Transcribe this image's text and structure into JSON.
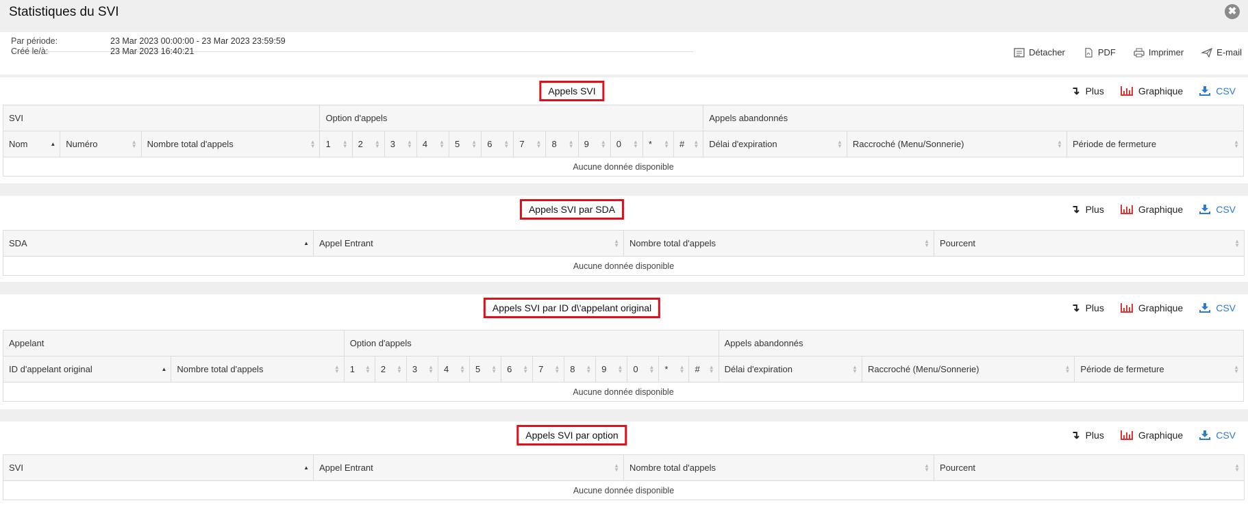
{
  "window": {
    "title": "Statistiques du SVI",
    "close_glyph": "✖"
  },
  "info": {
    "period_label": "Par période:",
    "period_value": "23 Mar 2023 00:00:00 - 23 Mar 2023 23:59:59",
    "created_label": "Créé le/à:",
    "created_value": "23 Mar 2023 16:40:21"
  },
  "actions": {
    "detach": "Détacher",
    "pdf": "PDF",
    "print": "Imprimer",
    "email": "E-mail"
  },
  "tools": {
    "plus": "Plus",
    "chart": "Graphique",
    "csv": "CSV"
  },
  "empty_text": "Aucune donnée disponible",
  "sections": [
    {
      "title": "Appels SVI",
      "groups": [
        "SVI",
        "Option d'appels",
        "Appels abandonnés"
      ],
      "columns": [
        "Nom",
        "Numéro",
        "Nombre total d'appels",
        "1",
        "2",
        "3",
        "4",
        "5",
        "6",
        "7",
        "8",
        "9",
        "0",
        "*",
        "#",
        "Délai d'expiration",
        "Raccroché (Menu/Sonnerie)",
        "Période de fermeture"
      ]
    },
    {
      "title": "Appels SVI par SDA",
      "columns": [
        "SDA",
        "Appel Entrant",
        "Nombre total d'appels",
        "Pourcent"
      ]
    },
    {
      "title": "Appels SVI par ID d\\'appelant original",
      "groups": [
        "Appelant",
        "Option d'appels",
        "Appels abandonnés"
      ],
      "columns": [
        "ID d'appelant original",
        "Nombre total d'appels",
        "1",
        "2",
        "3",
        "4",
        "5",
        "6",
        "7",
        "8",
        "9",
        "0",
        "*",
        "#",
        "Délai d'expiration",
        "Raccroché (Menu/Sonnerie)",
        "Période de fermeture"
      ]
    },
    {
      "title": "Appels SVI par option",
      "columns": [
        "SVI",
        "Appel Entrant",
        "Nombre total d'appels",
        "Pourcent"
      ]
    }
  ]
}
